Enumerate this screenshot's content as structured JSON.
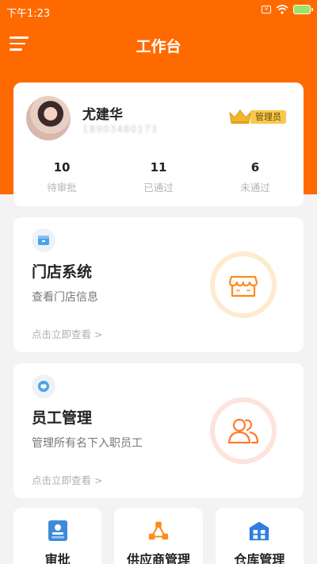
{
  "status_bar": {
    "time": "下午1:23"
  },
  "header": {
    "title": "工作台"
  },
  "profile": {
    "name": "尤建华",
    "phone": "18903480173",
    "role": "管理员",
    "stats": [
      {
        "value": "10",
        "label": "待审批"
      },
      {
        "value": "11",
        "label": "已通过"
      },
      {
        "value": "6",
        "label": "未通过"
      }
    ]
  },
  "store_card": {
    "title": "门店系统",
    "desc": "查看门店信息",
    "link": "点击立即查看 >",
    "icon": "store-icon"
  },
  "staff_card": {
    "title": "员工管理",
    "desc": "管理所有名下入职员工",
    "link": "点击立即查看 >",
    "icon": "people-icon"
  },
  "tiles": [
    {
      "label": "审批",
      "icon": "approval-icon",
      "color": "#3d8bd9"
    },
    {
      "label": "供应商管理",
      "icon": "supplier-icon",
      "color": "#ff8a1a"
    },
    {
      "label": "仓库管理",
      "icon": "warehouse-icon",
      "color": "#2f7de0"
    }
  ],
  "colors": {
    "brand": "#ff6a00",
    "badge": "#f6c94d"
  }
}
